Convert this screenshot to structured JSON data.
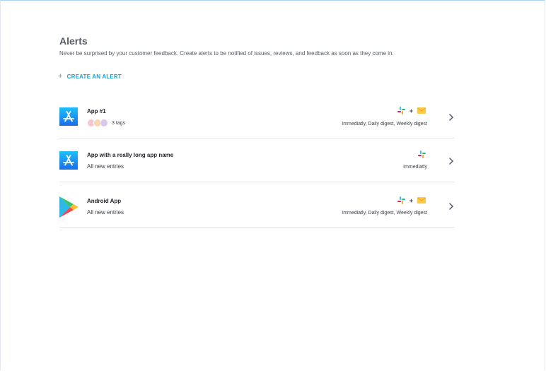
{
  "page": {
    "title": "Alerts",
    "subtitle": "Never be surprised by your customer feedback. Create alerts to be notified of issues, reviews, and feedback as soon as they come in.",
    "create_label": "CREATE AN ALERT",
    "accent_color": "#18a6d8"
  },
  "alerts": [
    {
      "icon": "app-store-icon",
      "name": "App #1",
      "tags_label": "3 tags",
      "tag_colors": [
        "#f5c6cf",
        "#f9d7b5",
        "#d9c7ef"
      ],
      "channels": [
        "slack-icon",
        "mail-icon"
      ],
      "frequency": "Immediatly,  Daily digest,  Weekly digest"
    },
    {
      "icon": "app-store-icon",
      "name": "App with a really long app name",
      "subtitle": "All new entries",
      "channels": [
        "slack-icon"
      ],
      "frequency": "Immediatly"
    },
    {
      "icon": "google-play-icon",
      "name": "Android App",
      "subtitle": "All new entries",
      "channels": [
        "slack-icon",
        "mail-icon"
      ],
      "frequency": "Immediatly,  Daily digest,  Weekly digest"
    }
  ]
}
